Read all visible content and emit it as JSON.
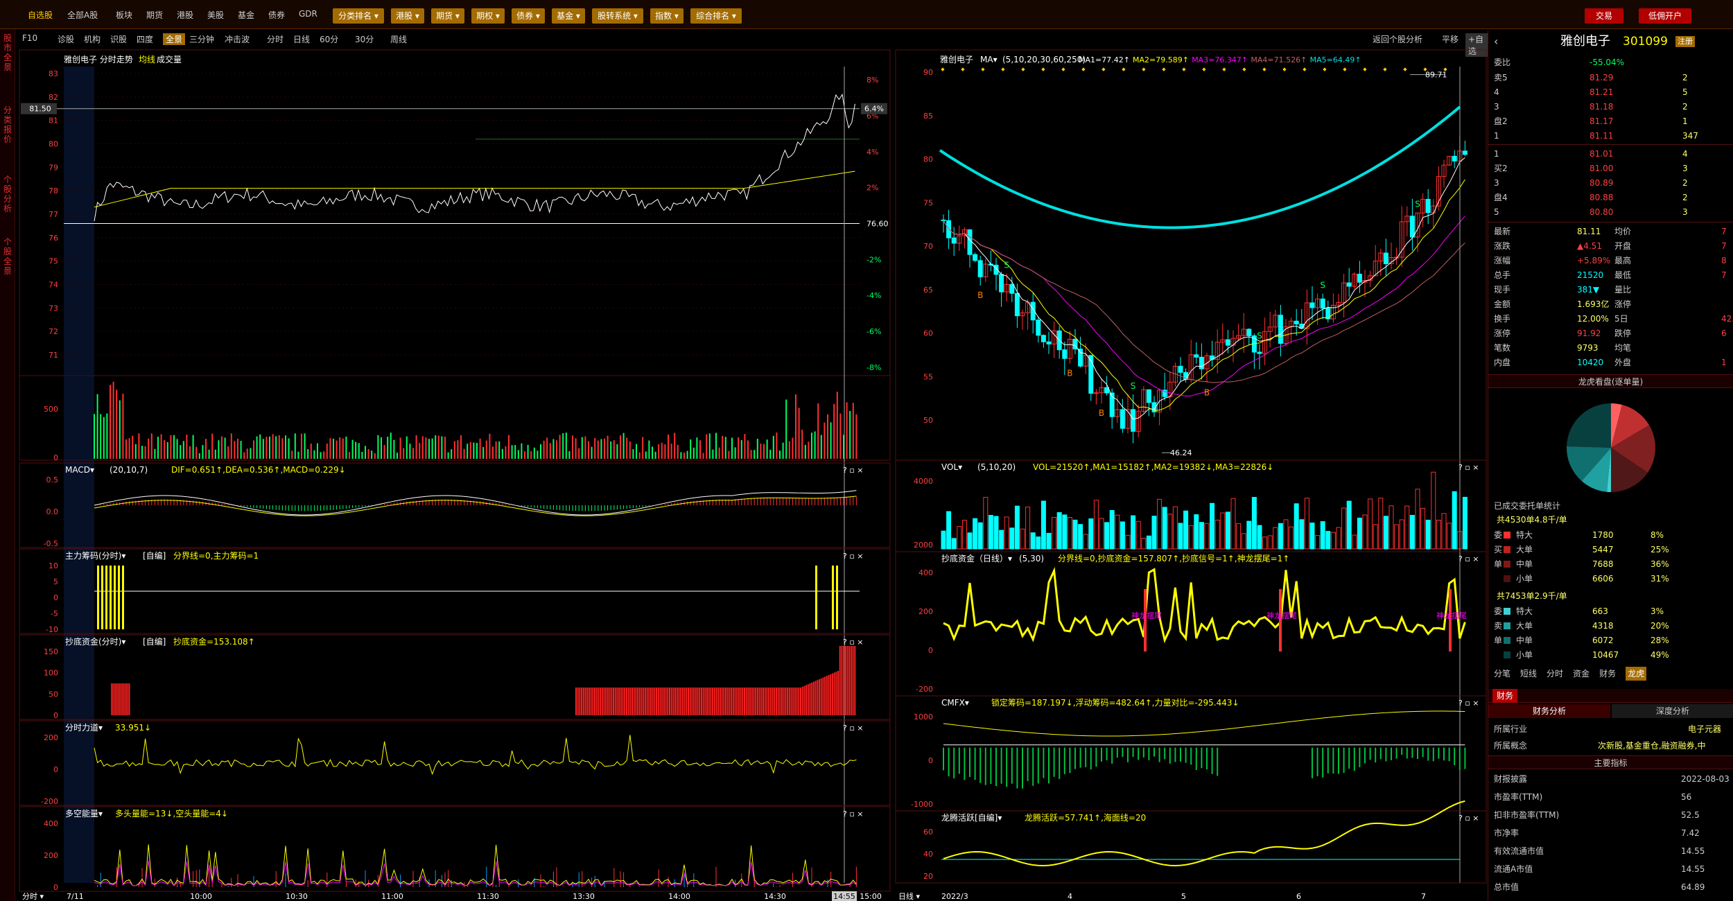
{
  "window": {
    "title": "雅创电子 301099"
  },
  "topbar": {
    "menu": [
      "自选股",
      "全部A股",
      "板块",
      "期货",
      "港股",
      "美股",
      "基金",
      "债券",
      "GDR"
    ],
    "tabs": [
      "分类排名",
      "港股",
      "期货",
      "期权",
      "债券",
      "基金",
      "股转系统",
      "指数",
      "综合排名"
    ],
    "trade_button": "交易",
    "open_account_button": "低佣开户"
  },
  "sidebar": {
    "items": [
      {
        "label": "股市全景"
      },
      {
        "label": "分类报价"
      },
      {
        "label": "个股分析"
      },
      {
        "label": "个股全景"
      }
    ]
  },
  "toolbar": {
    "left": [
      "F10",
      "诊股",
      "机构",
      "识股",
      "四度",
      "全景",
      "三分钟",
      "冲击波",
      "分时",
      "日线",
      "60分",
      "30分",
      "周线"
    ],
    "right": {
      "back": "返回个股分析",
      "flat": "平移",
      "watch": "+自选"
    }
  },
  "intraday": {
    "title": "雅创电子 分时走势",
    "legend_avg": "均线",
    "legend_vol": "成交量",
    "price_ticks": [
      "83",
      "82",
      "81",
      "80",
      "79",
      "78",
      "77",
      "76",
      "75",
      "74",
      "73",
      "72",
      "71"
    ],
    "pct_ticks": [
      "8%",
      "6%",
      "4%",
      "2%",
      "",
      "-2%",
      "-4%",
      "-6%",
      "-8%"
    ],
    "mid_price": "76.60",
    "current_price": "81.50",
    "current_pct": "6.4%",
    "time_ticks": [
      "7/11",
      "10:00",
      "10:30",
      "11:00",
      "11:30",
      "13:30",
      "14:00",
      "14:30",
      "14:55",
      "15:00"
    ],
    "time_label_left": "分时",
    "vol_ticks": [
      "500",
      "0"
    ],
    "panels": [
      {
        "title": "MACD",
        "params": "(20,10,7)",
        "vals": "DIF=0.651↑,DEA=0.536↑,MACD=0.229↓",
        "ticks": [
          "0.5",
          "0.0",
          "-0.5"
        ]
      },
      {
        "title": "主力筹码(分时)",
        "params": "[自编]",
        "vals": "分界线=0,主力筹码=1",
        "ticks": [
          "10",
          "5",
          "0",
          "-5",
          "-10"
        ]
      },
      {
        "title": "抄底资金(分时)",
        "params": "[自编]",
        "vals": "抄底资金=153.108↑",
        "ticks": [
          "150",
          "100",
          "50",
          "0"
        ]
      },
      {
        "title": "分时力道",
        "params": "",
        "vals": "33.951↓",
        "ticks": [
          "200",
          "0",
          "-200"
        ]
      },
      {
        "title": "多空能量",
        "params": "",
        "vals": "多头量能=13↓,空头量能=4↓",
        "ticks": [
          "400",
          "200",
          "0"
        ]
      }
    ]
  },
  "daily": {
    "title": "雅创电子",
    "ma": "MA",
    "ma_params": "(5,10,20,30,60,250)",
    "ma_vals": [
      "MA1=77.42↑",
      "MA2=79.589↑",
      "MA3=76.347↑",
      "MA4=71.526↑",
      "MA5=64.49↑"
    ],
    "ticks": [
      "90",
      "85",
      "80",
      "75",
      "70",
      "65",
      "60",
      "55",
      "50"
    ],
    "high_label": "89.71",
    "low_label": "46.24",
    "date_ticks": [
      "2022/3",
      "4",
      "5",
      "6",
      "7"
    ],
    "date_label_left": "日线",
    "panels": [
      {
        "title": "VOL",
        "params": "(5,10,20)",
        "vals": "VOL=21520↑,MA1=15182↑,MA2=19382↓,MA3=22826↓",
        "ticks": [
          "4000",
          "2000"
        ]
      },
      {
        "title": "抄底资金（日线）",
        "params": "(5,30)",
        "vals": "分界线=0,抄底资金=157.807↑,抄底信号=1↑,神龙摆尾=1↑",
        "ticks": [
          "400",
          "200",
          "0",
          "-200"
        ],
        "labels": [
          "神龙摆尾",
          "神龙摆尾",
          "神龙摆尾"
        ]
      },
      {
        "title": "CMFX",
        "params": "",
        "vals": "锁定筹码=187.197↓,浮动筹码=482.64↑,力量对比=-295.443↓",
        "ticks": [
          "1000",
          "0",
          "-1000"
        ]
      },
      {
        "title": "龙腾活跃[自编]",
        "params": "",
        "vals": "龙腾活跃=57.741↑,海面线=20",
        "ticks": [
          "60",
          "40",
          "20"
        ]
      }
    ]
  },
  "quote": {
    "name": "雅创电子",
    "code": "301099",
    "badge": "注册",
    "weibi_label": "委比",
    "weibi": "-55.04%",
    "sell": [
      {
        "label": "卖5",
        "price": "81.29",
        "vol": "2"
      },
      {
        "label": "4",
        "price": "81.21",
        "vol": "5"
      },
      {
        "label": "3",
        "price": "81.18",
        "vol": "2"
      },
      {
        "label": "盘2",
        "price": "81.17",
        "vol": "1"
      },
      {
        "label": "1",
        "price": "81.11",
        "vol": "347"
      }
    ],
    "buy": [
      {
        "label": "1",
        "price": "81.01",
        "vol": "4"
      },
      {
        "label": "买2",
        "price": "81.00",
        "vol": "3"
      },
      {
        "label": "3",
        "price": "80.89",
        "vol": "2"
      },
      {
        "label": "盘4",
        "price": "80.88",
        "vol": "2"
      },
      {
        "label": "5",
        "price": "80.80",
        "vol": "3"
      }
    ],
    "stats": [
      {
        "k": "最新",
        "v": "81.11",
        "k2": "均价",
        "v2": "7"
      },
      {
        "k": "涨跌",
        "v": "▲4.51",
        "k2": "开盘",
        "v2": "7"
      },
      {
        "k": "涨幅",
        "v": "+5.89%",
        "k2": "最高",
        "v2": "8"
      },
      {
        "k": "总手",
        "v": "21520",
        "k2": "最低",
        "v2": "7"
      },
      {
        "k": "现手",
        "v": "381▼",
        "k2": "量比",
        "v2": ""
      },
      {
        "k": "金额",
        "v": "1.693亿",
        "k2": "涨停",
        "v2": ""
      },
      {
        "k": "换手",
        "v": "12.00%",
        "k2": "5日",
        "v2": "42."
      },
      {
        "k": "涨停",
        "v": "91.92",
        "k2": "跌停",
        "v2": "6"
      },
      {
        "k": "笔数",
        "v": "9793",
        "k2": "均笔",
        "v2": ""
      },
      {
        "k": "内盘",
        "v": "10420",
        "k2": "外盘",
        "v2": "1"
      }
    ],
    "pie_title": "龙虎看盘(逐单量)",
    "order_title": "已成交委托单统计",
    "buy_total": "共4530单4.8千/单",
    "buy_orders": [
      {
        "side": "委",
        "type": "特大",
        "n": "1780",
        "pct": "8%"
      },
      {
        "side": "买",
        "type": "大单",
        "n": "5447",
        "pct": "25%"
      },
      {
        "side": "单",
        "type": "中单",
        "n": "7688",
        "pct": "36%"
      },
      {
        "side": "",
        "type": "小单",
        "n": "6606",
        "pct": "31%"
      }
    ],
    "sell_total": "共7453单2.9千/单",
    "sell_orders": [
      {
        "side": "委",
        "type": "特大",
        "n": "663",
        "pct": "3%"
      },
      {
        "side": "卖",
        "type": "大单",
        "n": "4318",
        "pct": "20%"
      },
      {
        "side": "单",
        "type": "中单",
        "n": "6072",
        "pct": "28%"
      },
      {
        "side": "",
        "type": "小单",
        "n": "10467",
        "pct": "49%"
      }
    ],
    "bottom_tabs": [
      "分笔",
      "短线",
      "分时",
      "资金",
      "财务",
      "龙虎"
    ],
    "finance_tab": "财务",
    "finance_tabs": [
      "财务分析",
      "深度分析"
    ],
    "industry_label": "所属行业",
    "industry": "电子元器",
    "concept_label": "所属概念",
    "concept": "次新股,基金重仓,融资融券,中",
    "main_title": "主要指标",
    "fin_rows": [
      {
        "k": "财报披露",
        "v": "2022-08-03"
      },
      {
        "k": "市盈率(TTM)",
        "v": "56"
      },
      {
        "k": "扣非市盈率(TTM)",
        "v": "52.5"
      },
      {
        "k": "市净率",
        "v": "7.42"
      },
      {
        "k": "有效流通市值",
        "v": "14.55"
      },
      {
        "k": "流通A市值",
        "v": "14.55"
      },
      {
        "k": "总市值",
        "v": "64.89"
      }
    ]
  },
  "colors": {
    "up": "#ff3030",
    "down": "#00ffff",
    "ma5": "#ffffff",
    "ma10": "#ffff00",
    "ma20": "#ff00ff",
    "ma30": "#c06060",
    "ma60": "#00e0e0",
    "accent": "#a36b00"
  }
}
